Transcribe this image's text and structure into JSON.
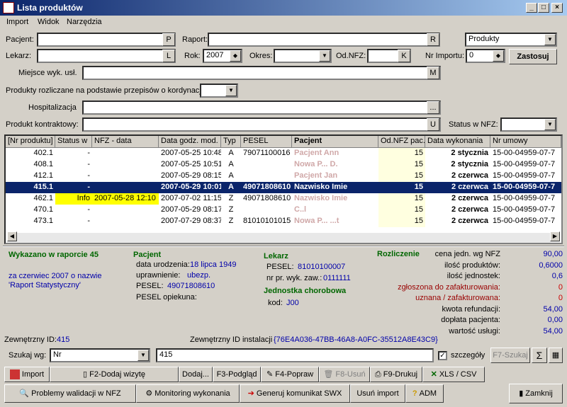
{
  "window": {
    "title": "Lista produktów"
  },
  "menu": [
    "Import",
    "Widok",
    "Narzędzia"
  ],
  "filters": {
    "pacjent_label": "Pacjent:",
    "lekarz_label": "Lekarz:",
    "raport_label": "Raport:",
    "rok_label": "Rok:",
    "rok_value": "2007",
    "okres_label": "Okres:",
    "odnfz_label": "Od.NFZ:",
    "nr_importu_label": "Nr Importu:",
    "nr_importu_value": "0",
    "produkty_select": "Produkty",
    "zastosuj": "Zastosuj",
    "miejsce_label": "Miejsce wyk. usł.",
    "przepisy_label": "Produkty rozliczane na podstawie przepisów o kordynacji:",
    "hospitalizacja_label": "Hospitalizacja",
    "kontraktowy_label": "Produkt kontraktowy:",
    "status_nfz_label": "Status w NFZ:",
    "btn_p": "P",
    "btn_l": "L",
    "btn_r": "R",
    "btn_k": "K",
    "btn_m": "M",
    "btn_u": "U",
    "btn_dots": "..."
  },
  "grid": {
    "headers": [
      "[Nr produktu]",
      "Status w",
      "NFZ - data",
      "Data godz. mod.",
      "Typ",
      "PESEL",
      "Pacjent",
      "Od.NFZ pac.",
      "Data wykonania",
      "Nr umowy"
    ],
    "rows": [
      {
        "nr": "402.1",
        "status": "-",
        "nfz": "",
        "mod": "2007-05-25 10:48",
        "typ": "A",
        "pesel": "79071100016",
        "pacjent": "Pacjent Ann",
        "od": "15",
        "data": "2 stycznia",
        "umowa": "15-00-04959-07-7"
      },
      {
        "nr": "408.1",
        "status": "-",
        "nfz": "",
        "mod": "2007-05-25 10:51",
        "typ": "A",
        "pesel": "",
        "pacjent": "Nowa P... D.",
        "od": "15",
        "data": "2 stycznia",
        "umowa": "15-00-04959-07-7"
      },
      {
        "nr": "412.1",
        "status": "-",
        "nfz": "",
        "mod": "2007-05-29 08:15",
        "typ": "A",
        "pesel": "",
        "pacjent": "Pacjent Jan",
        "od": "15",
        "data": "2 czerwca",
        "umowa": "15-00-04959-07-7"
      },
      {
        "nr": "415.1",
        "status": "-",
        "nfz": "",
        "mod": "2007-05-29 10:01",
        "typ": "A",
        "pesel": "49071808610",
        "pacjent": "Nazwisko Imie",
        "od": "15",
        "data": "2 czerwca",
        "umowa": "15-00-04959-07-7"
      },
      {
        "nr": "462.1",
        "status": "Info",
        "nfz": "2007-05-28 12:10",
        "mod": "2007-07-02 11:15",
        "typ": "Z",
        "pesel": "49071808610",
        "pacjent": "Nazwisko Imie",
        "od": "15",
        "data": "2 czerwca",
        "umowa": "15-00-04959-07-7"
      },
      {
        "nr": "470.1",
        "status": "-",
        "nfz": "",
        "mod": "2007-05-29 08:17",
        "typ": "Z",
        "pesel": "",
        "pacjent": "C..l",
        "od": "15",
        "data": "2 czerwca",
        "umowa": "15-00-04959-07-7"
      },
      {
        "nr": "473.1",
        "status": "-",
        "nfz": "",
        "mod": "2007-07-29 08:37",
        "typ": "Z",
        "pesel": "81010101015",
        "pacjent": "Nowa P... ...t",
        "od": "15",
        "data": "2 czerwca",
        "umowa": "15-00-04959-07-7"
      }
    ]
  },
  "detail": {
    "raport_title": "Wykazano w raporcie 45",
    "raport_sub1": "za czerwiec 2007 o nazwie",
    "raport_sub2": "'Raport Statystyczny'",
    "pacjent_title": "Pacjent",
    "dob_label": "data urodzenia:",
    "dob_value": "18 lipca 1949",
    "upr_label": "uprawnienie:",
    "upr_value": "ubezp.",
    "pesel_label": "PESEL:",
    "pesel_value": "49071808610",
    "pesel_op_label": "PESEL opiekuna:",
    "lekarz_title": "Lekarz",
    "lek_pesel_label": "PESEL:",
    "lek_pesel_value": "81010100007",
    "lek_nr_label": "nr pr. wyk. zaw.:",
    "lek_nr_value": "0111111",
    "jedn_title": "Jednostka chorobowa",
    "kod_label": "kod:",
    "kod_value": "J00",
    "rozl_title": "Rozliczenie",
    "rozl": [
      {
        "label": "cena jedn. wg NFZ",
        "value": "90,00",
        "lc": "#000",
        "vc": "#0000aa"
      },
      {
        "label": "ilość produktów:",
        "value": "0,6000",
        "lc": "#000",
        "vc": "#0000aa"
      },
      {
        "label": "ilość jednostek:",
        "value": "0,6",
        "lc": "#000",
        "vc": "#0000aa"
      },
      {
        "label": "zgłoszona do zafakturowania:",
        "value": "0",
        "lc": "#990000",
        "vc": "#cc0000"
      },
      {
        "label": "uznana / zafakturowana:",
        "value": "0",
        "lc": "#990000",
        "vc": "#cc0000"
      },
      {
        "label": "kwota refundacji:",
        "value": "54,00",
        "lc": "#000",
        "vc": "#0000aa"
      },
      {
        "label": "dopłata pacjenta:",
        "value": "0,00",
        "lc": "#000",
        "vc": "#0000aa"
      },
      {
        "label": "wartość usługi:",
        "value": "54,00",
        "lc": "#000",
        "vc": "#0000aa"
      }
    ],
    "zid_label": "Zewnętrzny ID:",
    "zid_value": "415",
    "zid_inst_label": "Zewnętrzny ID instalacji",
    "zid_inst_value": "{76E4A036-47BB-46A8-A0FC-35512A8E43C9}"
  },
  "search": {
    "label": "Szukaj wg:",
    "by": "Nr",
    "value": "415",
    "details": "szczegóły",
    "f7": "F7-Szukaj",
    "sigma": "Σ"
  },
  "toolbar1": [
    "Import",
    "F2-Dodaj wizytę",
    "Dodaj...",
    "F3-Podgląd",
    "F4-Popraw",
    "F8-Usuń",
    "F9-Drukuj",
    "XLS / CSV"
  ],
  "toolbar2": [
    "Problemy walidacji w NFZ",
    "Monitoring wykonania",
    "Generuj komunikat SWX",
    "Usuń import",
    "ADM",
    "Zamknij"
  ]
}
